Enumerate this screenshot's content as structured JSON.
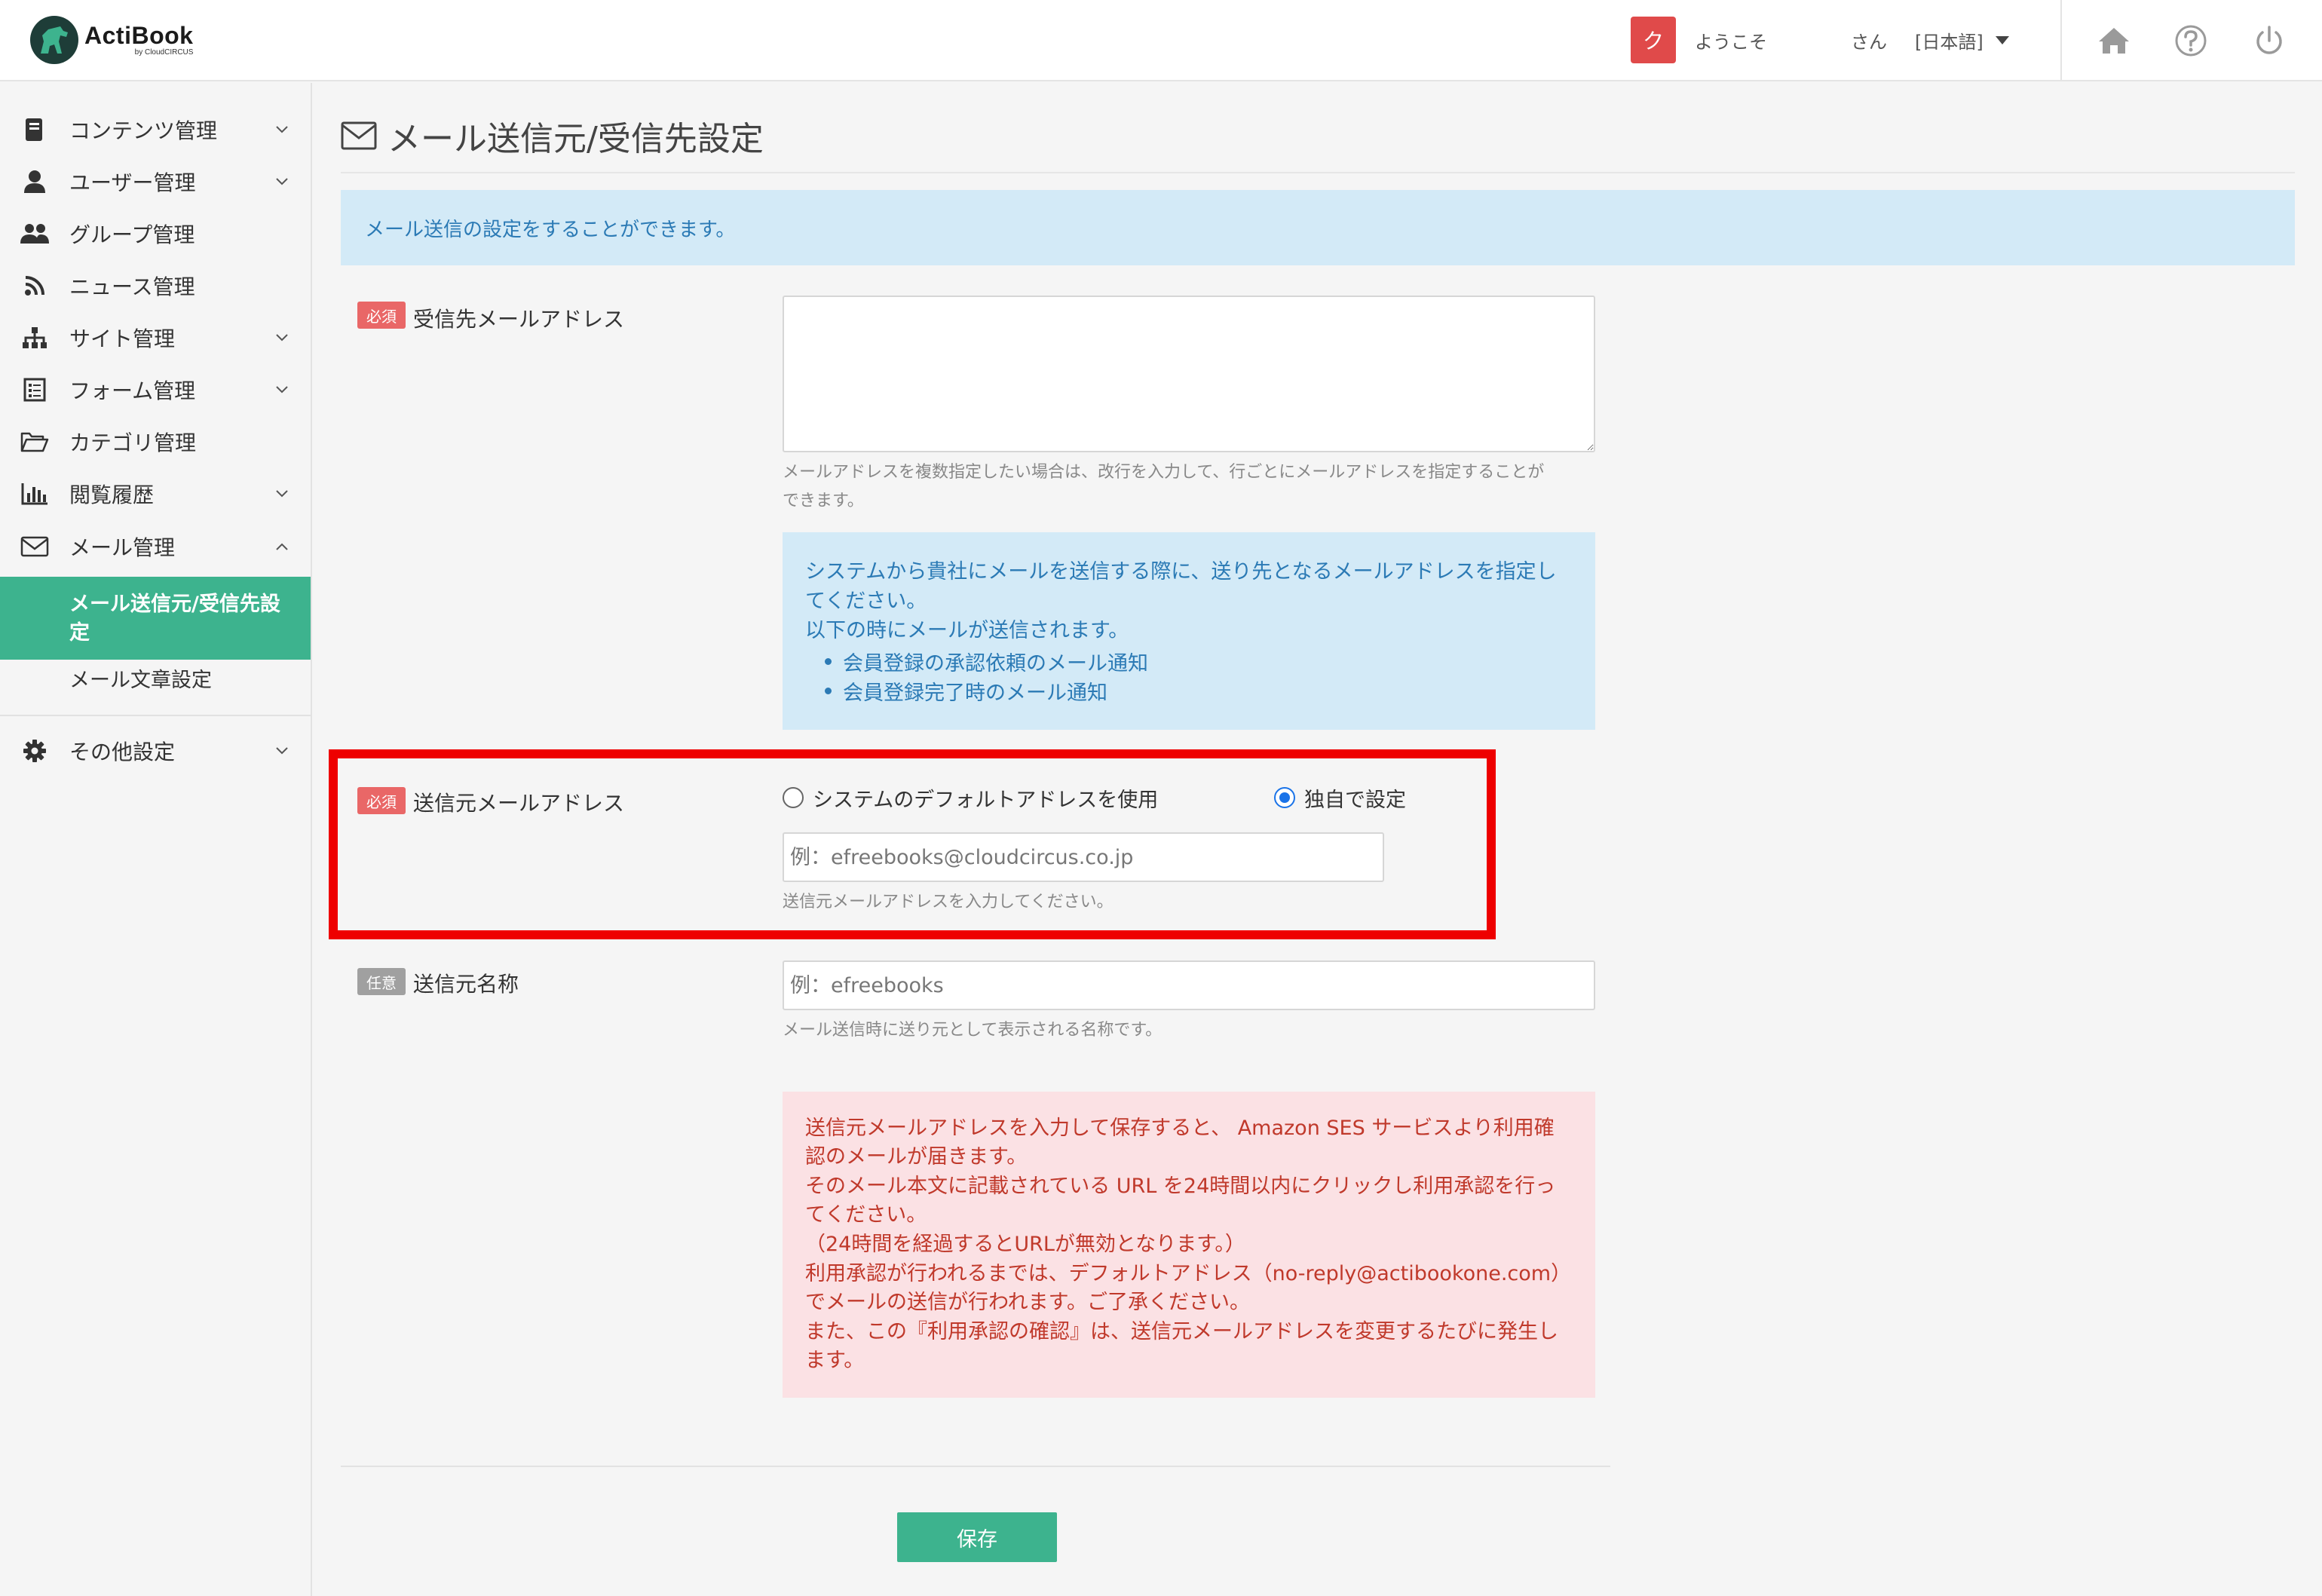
{
  "header": {
    "logo_name": "ActiBook",
    "logo_sub": "by CloudCIRCUS",
    "user_initial": "ク",
    "welcome": "ようこそ",
    "user_suffix": "さん",
    "language": "[日本語]",
    "icons": [
      "home-icon",
      "help-icon",
      "power-icon"
    ]
  },
  "sidebar": {
    "items": [
      {
        "label": "コンテンツ管理",
        "icon": "book-icon",
        "expandable": true
      },
      {
        "label": "ユーザー管理",
        "icon": "user-icon",
        "expandable": true
      },
      {
        "label": "グループ管理",
        "icon": "users-icon",
        "expandable": false
      },
      {
        "label": "ニュース管理",
        "icon": "rss-icon",
        "expandable": false
      },
      {
        "label": "サイト管理",
        "icon": "sitemap-icon",
        "expandable": true
      },
      {
        "label": "フォーム管理",
        "icon": "form-icon",
        "expandable": true
      },
      {
        "label": "カテゴリ管理",
        "icon": "folder-icon",
        "expandable": false
      },
      {
        "label": "閲覧履歴",
        "icon": "bar-chart-icon",
        "expandable": true
      },
      {
        "label": "メール管理",
        "icon": "envelope-icon",
        "expandable": true,
        "expanded": true
      }
    ],
    "mail_sub": {
      "active": "メール送信元/受信先設定",
      "other": "メール文章設定"
    },
    "other_settings": "その他設定"
  },
  "page": {
    "title": "メール送信元/受信先設定",
    "info": "メール送信の設定をすることができます。"
  },
  "form": {
    "required_badge": "必須",
    "optional_badge": "任意",
    "recipient": {
      "label": "受信先メールアドレス",
      "value": "",
      "help_line1": "メールアドレスを複数指定したい場合は、改行を入力して、行ごとにメールアドレスを指定することが",
      "help_line2": "できます。",
      "info_line1": "システムから貴社にメールを送信する際に、送り先となるメールアドレスを指定し",
      "info_line2": "てください。",
      "info_line3": "以下の時にメールが送信されます。",
      "info_bullet1": "会員登録の承認依頼のメール通知",
      "info_bullet2": "会員登録完了時のメール通知"
    },
    "sender": {
      "label": "送信元メールアドレス",
      "option_default": "システムのデフォルトアドレスを使用",
      "option_custom": "独自で設定",
      "selected": "custom",
      "placeholder": "例：efreebooks@cloudcircus.co.jp",
      "value": "",
      "help": "送信元メールアドレスを入力してください。"
    },
    "sender_name": {
      "label": "送信元名称",
      "placeholder": "例：efreebooks",
      "value": "",
      "help": "メール送信時に送り元として表示される名称です。"
    },
    "warning_lines": [
      "送信元メールアドレスを入力して保存すると、 Amazon SES サービスより利用確",
      "認のメールが届きます。",
      "そのメール本文に記載されている URL を24時間以内にクリックし利用承認を行っ",
      "てください。",
      "（24時間を経過するとURLが無効となります。）",
      "利用承認が行われるまでは、デフォルトアドレス（no-reply@actibookone.com）",
      "でメールの送信が行われます。ご了承ください。",
      "また、この『利用承認の確認』は、送信元メールアドレスを変更するたびに発生し",
      "ます。"
    ],
    "save_label": "保存"
  },
  "colors": {
    "accent": "#3db38e",
    "info_bg": "#d3eaf7",
    "info_text": "#2b7ab5",
    "warning_bg": "#fbe1e4",
    "warning_text": "#c0392b",
    "required": "#e96767",
    "highlight": "#ee0000"
  }
}
